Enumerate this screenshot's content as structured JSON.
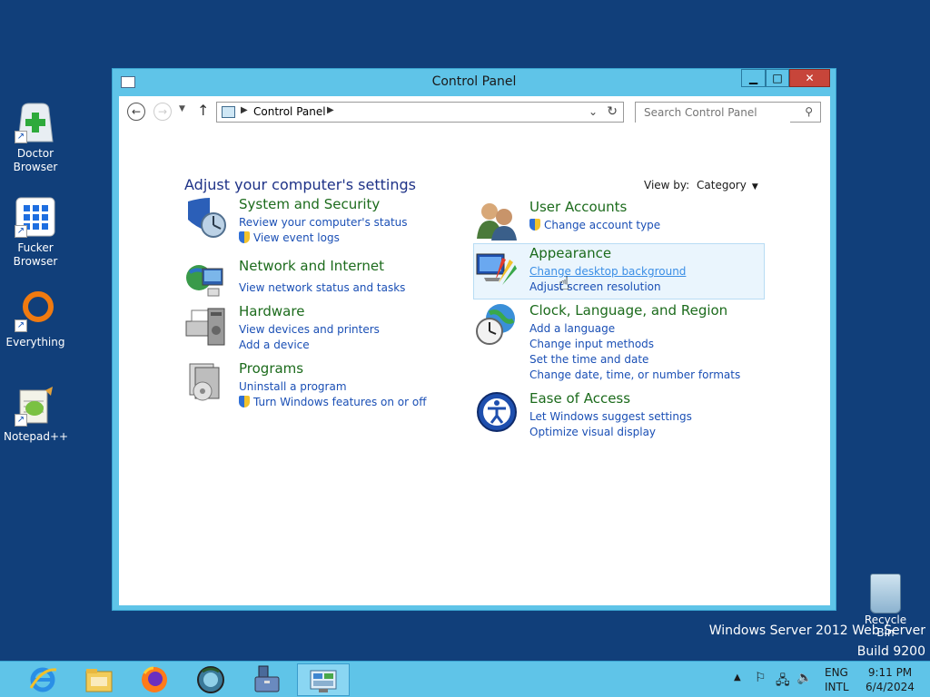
{
  "desktop": {
    "icons": [
      {
        "label": "Doctor Browser"
      },
      {
        "label": "Fucker Browser"
      },
      {
        "label": "Everything"
      },
      {
        "label": "Notepad++"
      }
    ],
    "recycle_bin": "Recycle Bin",
    "watermark_line1": "Windows Server 2012 Web Server",
    "watermark_line2": "Build 9200"
  },
  "window": {
    "title": "Control Panel",
    "buttons": {
      "minimize": "▁",
      "maximize": "□",
      "close": "✕"
    }
  },
  "nav": {
    "back": "←",
    "forward": "→",
    "up": "↑",
    "breadcrumb": "Control Panel",
    "search_placeholder": "Search Control Panel"
  },
  "main": {
    "heading": "Adjust your computer's settings",
    "view_by_label": "View by:",
    "view_by_value": "Category"
  },
  "categories": {
    "system": {
      "title": "System and Security",
      "links": [
        "Review your computer's status",
        "View event logs"
      ]
    },
    "network": {
      "title": "Network and Internet",
      "links": [
        "View network status and tasks"
      ]
    },
    "hardware": {
      "title": "Hardware",
      "links": [
        "View devices and printers",
        "Add a device"
      ]
    },
    "programs": {
      "title": "Programs",
      "links": [
        "Uninstall a program",
        "Turn Windows features on or off"
      ]
    },
    "users": {
      "title": "User Accounts",
      "links": [
        "Change account type"
      ]
    },
    "appearance": {
      "title": "Appearance",
      "links": [
        "Change desktop background",
        "Adjust screen resolution"
      ]
    },
    "clock": {
      "title": "Clock, Language, and Region",
      "links": [
        "Add a language",
        "Change input methods",
        "Set the time and date",
        "Change date, time, or number formats"
      ]
    },
    "ease": {
      "title": "Ease of Access",
      "links": [
        "Let Windows suggest settings",
        "Optimize visual display"
      ]
    }
  },
  "taskbar": {
    "lang_line1": "ENG",
    "lang_line2": "INTL",
    "time": "9:11 PM",
    "date": "6/4/2024"
  },
  "colors": {
    "desktop_bg": "#113f7a",
    "window_chrome": "#5fc4e8",
    "category_title": "#1c6b1c",
    "link": "#1a4fb5",
    "heading": "#1e3287",
    "close_button": "#c7453a"
  }
}
